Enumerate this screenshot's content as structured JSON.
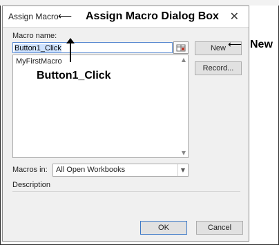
{
  "dialog": {
    "title": "Assign Macro",
    "close_label": "✕",
    "macro_name_label": "Macro name:",
    "macro_name_value": "Button1_Click",
    "macro_list": [
      "MyFirstMacro"
    ],
    "new_label": "New",
    "record_label": "Record...",
    "macros_in_label": "Macros in:",
    "macros_in_value": "All Open Workbooks",
    "description_label": "Description",
    "ok_label": "OK",
    "cancel_label": "Cancel"
  },
  "annotations": {
    "title_callout": "Assign Macro Dialog Box",
    "name_callout": "Button1_Click",
    "new_callout": "New"
  },
  "icons": {
    "ref_button": "range-select-icon",
    "scroll_up": "chevron-up-icon",
    "scroll_down": "chevron-down-icon"
  }
}
